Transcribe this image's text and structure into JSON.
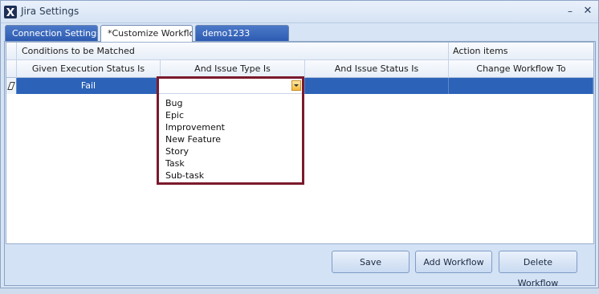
{
  "window": {
    "title": "Jira Settings",
    "minimize": "–",
    "close": "✕"
  },
  "tabs": [
    {
      "label": "Connection Settings",
      "active": false
    },
    {
      "label": "*Customize Workflow",
      "active": true
    },
    {
      "label": "demo1233",
      "active": false
    }
  ],
  "grid": {
    "groups": {
      "conditions": "Conditions to be Matched",
      "actions": "Action items"
    },
    "columns": [
      "Given Execution Status Is",
      "And Issue Type Is",
      "And Issue Status Is",
      "Change Workflow To"
    ],
    "rows": [
      {
        "execution_status": "Fail",
        "issue_type": "",
        "issue_status": "",
        "workflow": ""
      }
    ]
  },
  "dropdown": {
    "options": [
      "Bug",
      "Epic",
      "Improvement",
      "New Feature",
      "Story",
      "Task",
      "Sub-task"
    ]
  },
  "buttons": {
    "save": "Save",
    "add_workflow": "Add Workflow",
    "delete_workflow": "Delete Workflow"
  },
  "colors": {
    "selected_row": "#2c63b8",
    "dropdown_highlight_border": "#7b1a2c",
    "tab_inactive": "#2d5bb1"
  }
}
